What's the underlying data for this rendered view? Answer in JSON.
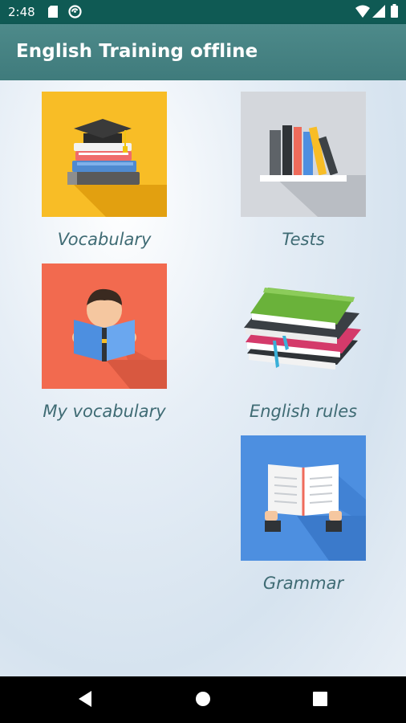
{
  "status_bar": {
    "time": "2:48",
    "icons": [
      "sd-card-icon",
      "sync-icon",
      "wifi-icon",
      "cellular-icon",
      "battery-icon"
    ]
  },
  "app_bar": {
    "title": "English Training offline"
  },
  "menu": [
    {
      "label": "Vocabulary",
      "color": "#f8bd26",
      "icon": "graduation-books-icon"
    },
    {
      "label": "Tests",
      "color": "#d4d7dc",
      "icon": "bookshelf-icon"
    },
    {
      "label": "My vocabulary",
      "color": "#f26a4f",
      "icon": "reading-boy-icon"
    },
    {
      "label": "English rules",
      "color": "transparent",
      "icon": "book-stack-icon"
    },
    {
      "label": "Grammar",
      "color": "#4d8fe0",
      "icon": "open-book-hands-icon"
    }
  ],
  "nav_bar": {
    "buttons": [
      "back",
      "home",
      "recents"
    ]
  },
  "colors": {
    "status_bar": "#0f5a54",
    "app_bar": "#4a8687",
    "label_text": "#3f6b74"
  }
}
